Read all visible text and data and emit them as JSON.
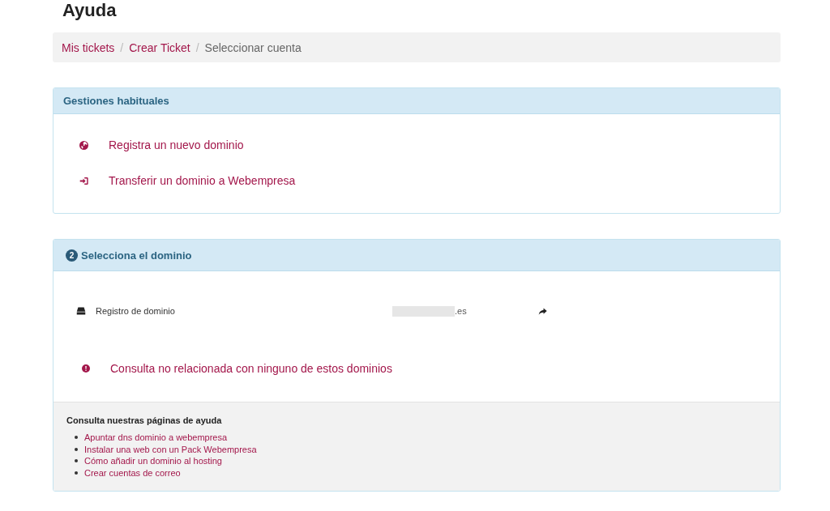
{
  "page_title": "Ayuda",
  "breadcrumb": {
    "separator": "/",
    "items": [
      {
        "label": "Mis tickets",
        "current": false
      },
      {
        "label": "Crear Ticket",
        "current": false
      },
      {
        "label": "Seleccionar cuenta",
        "current": true
      }
    ]
  },
  "common_tasks": {
    "title": "Gestiones habituales",
    "items": [
      {
        "kind": "globe",
        "label": "Registra un nuevo dominio"
      },
      {
        "kind": "sign-in",
        "label": "Transferir un dominio a Webempresa"
      }
    ]
  },
  "select_domain": {
    "step": "2",
    "title": "Selecciona el dominio",
    "items": [
      {
        "kind": "account",
        "type": "Registro de dominio",
        "domain": ".es",
        "redacted": true
      },
      {
        "kind": "other",
        "label": "Consulta no relacionada con ninguno de estos dominios"
      }
    ]
  },
  "help": {
    "title": "Consulta nuestras páginas de ayuda",
    "links": [
      "Apuntar dns dominio a webempresa",
      "Instalar una web con un Pack Webempresa",
      "Cómo añadir un dominio al hosting",
      "Crear cuentas de correo"
    ]
  }
}
